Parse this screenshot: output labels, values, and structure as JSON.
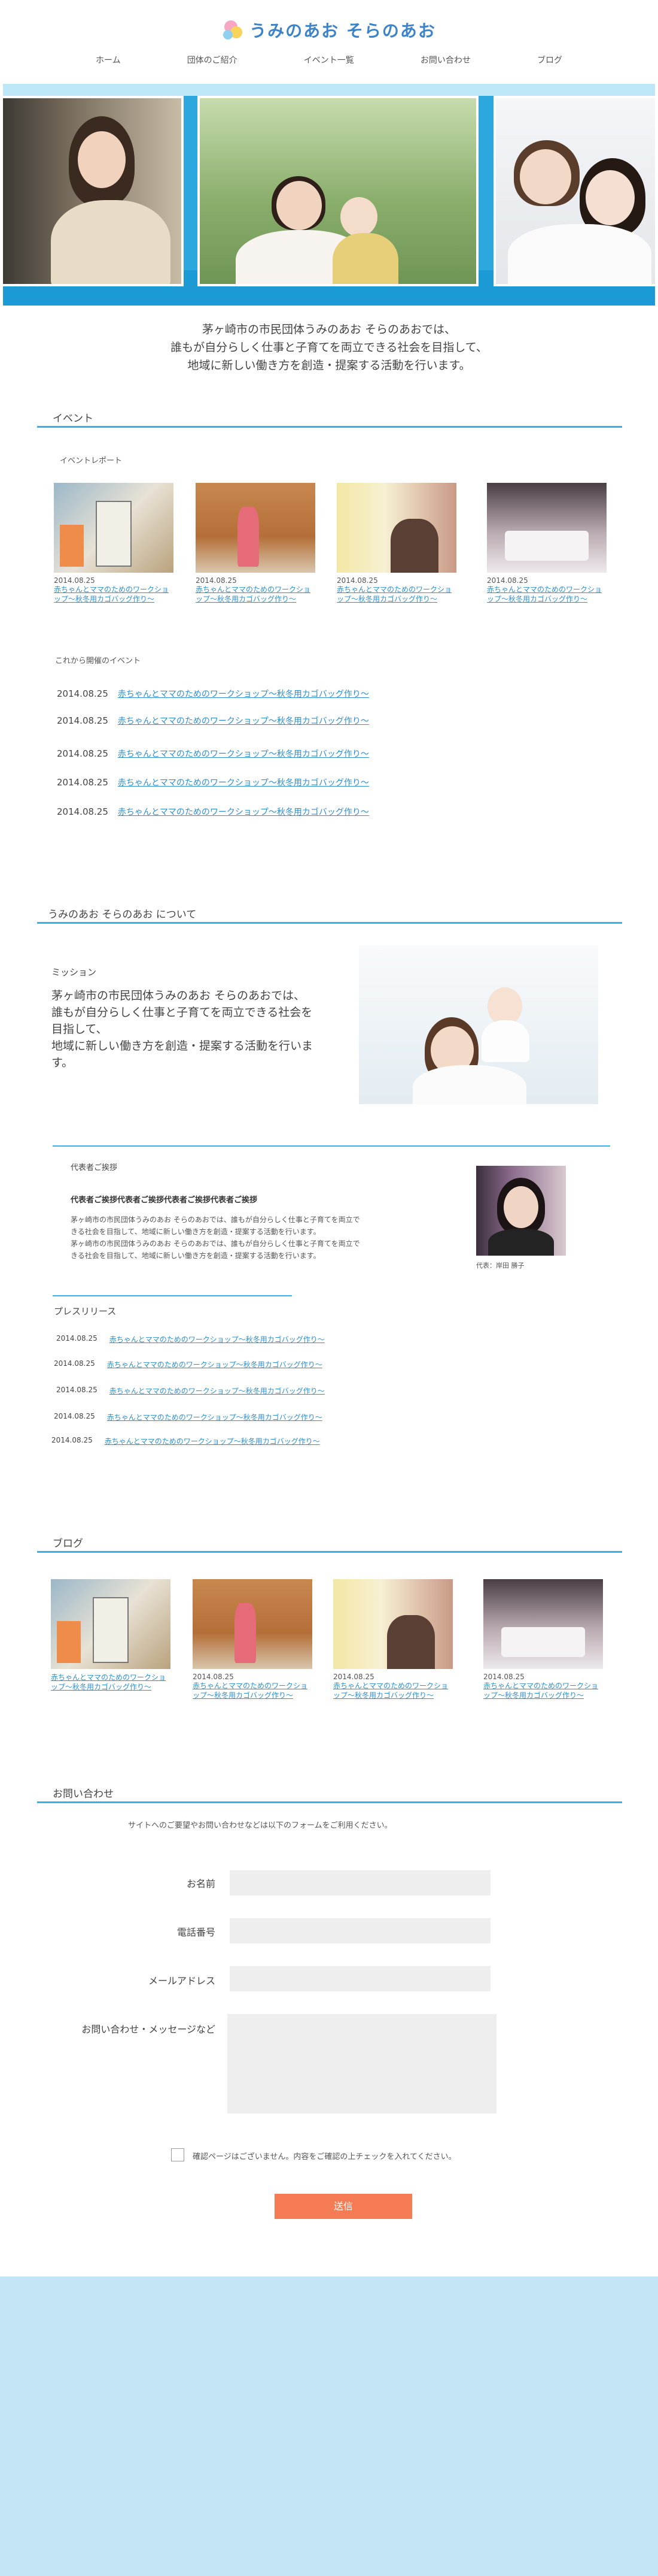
{
  "site": {
    "title": "うみのあお そらのあお"
  },
  "nav": [
    {
      "label": "ホーム"
    },
    {
      "label": "団体のご紹介"
    },
    {
      "label": "イベント一覧"
    },
    {
      "label": "お問い合わせ"
    },
    {
      "label": "ブログ"
    }
  ],
  "mission": {
    "line1": "茅ヶ崎市の市民団体うみのあお そらのあおでは、",
    "line2": "誰もが自分らしく仕事と子育てを両立できる社会を目指して、",
    "line3": "地域に新しい働き方を創造・提案する活動を行います。"
  },
  "events": {
    "heading": "イベント",
    "report_heading": "イベントレポート",
    "reports": [
      {
        "date": "2014.08.25",
        "title": "赤ちゃんとママのためのワークショップ〜秋冬用カゴバッグ作り〜"
      },
      {
        "date": "2014.08.25",
        "title": "赤ちゃんとママのためのワークショップ〜秋冬用カゴバッグ作り〜"
      },
      {
        "date": "2014.08.25",
        "title": "赤ちゃんとママのためのワークショップ〜秋冬用カゴバッグ作り〜"
      },
      {
        "date": "2014.08.25",
        "title": "赤ちゃんとママのためのワークショップ〜秋冬用カゴバッグ作り〜"
      }
    ],
    "upcoming_heading": "これから開催のイベント",
    "upcoming": [
      {
        "date": "2014.08.25",
        "title": "赤ちゃんとママのためのワークショップ〜秋冬用カゴバッグ作り〜"
      },
      {
        "date": "2014.08.25",
        "title": "赤ちゃんとママのためのワークショップ〜秋冬用カゴバッグ作り〜"
      },
      {
        "date": "2014.08.25",
        "title": "赤ちゃんとママのためのワークショップ〜秋冬用カゴバッグ作り〜"
      },
      {
        "date": "2014.08.25",
        "title": "赤ちゃんとママのためのワークショップ〜秋冬用カゴバッグ作り〜"
      },
      {
        "date": "2014.08.25",
        "title": "赤ちゃんとママのためのワークショップ〜秋冬用カゴバッグ作り〜"
      }
    ]
  },
  "about": {
    "heading": "うみのあお そらのあお について",
    "mission_label": "ミッション",
    "mission_line1": "茅ヶ崎市の市民団体うみのあお そらのあおでは、",
    "mission_line2": "誰もが自分らしく仕事と子育てを両立できる社会を",
    "mission_line3": "目指して、",
    "mission_line4": "地域に新しい働き方を創造・提案する活動を行いま",
    "mission_line5": "す。",
    "greeting_heading": "代表者ご挨拶",
    "greeting_title": "代表者ご挨拶代表者ご挨拶代表者ご挨拶代表者ご挨拶",
    "greeting_line1": "茅ヶ崎市の市民団体うみのあお そらのあおでは、誰もが自分らしく仕事と子育てを両立で",
    "greeting_line2": "きる社会を目指して、地域に新しい働き方を創造・提案する活動を行います。",
    "greeting_line3": "茅ヶ崎市の市民団体うみのあお そらのあおでは、誰もが自分らしく仕事と子育てを両立で",
    "greeting_line4": "きる社会を目指して、地域に新しい働き方を創造・提案する活動を行います。",
    "rep_caption": "代表：岸田 勝子"
  },
  "press": {
    "heading": "プレスリリース",
    "items": [
      {
        "date": "2014.08.25",
        "title": "赤ちゃんとママのためのワークショップ〜秋冬用カゴバッグ作り〜"
      },
      {
        "date": "2014.08.25",
        "title": "赤ちゃんとママのためのワークショップ〜秋冬用カゴバッグ作り〜"
      },
      {
        "date": "2014.08.25",
        "title": "赤ちゃんとママのためのワークショップ〜秋冬用カゴバッグ作り〜"
      },
      {
        "date": "2014.08.25",
        "title": "赤ちゃんとママのためのワークショップ〜秋冬用カゴバッグ作り〜"
      },
      {
        "date": "2014.08.25",
        "title": "赤ちゃんとママのためのワークショップ〜秋冬用カゴバッグ作り〜"
      }
    ]
  },
  "blog": {
    "heading": "ブログ",
    "items": [
      {
        "date": "",
        "title": "赤ちゃんとママのためのワークショップ〜秋冬用カゴバッグ作り〜"
      },
      {
        "date": "2014.08.25",
        "title": "赤ちゃんとママのためのワークショップ〜秋冬用カゴバッグ作り〜"
      },
      {
        "date": "2014.08.25",
        "title": "赤ちゃんとママのためのワークショップ〜秋冬用カゴバッグ作り〜"
      },
      {
        "date": "2014.08.25",
        "title": "赤ちゃんとママのためのワークショップ〜秋冬用カゴバッグ作り〜"
      }
    ]
  },
  "contact": {
    "heading": "お問い合わせ",
    "intro": "サイトへのご要望やお問い合わせなどは以下のフォームをご利用ください。",
    "name_label": "お名前",
    "phone_label": "電話番号",
    "email_label": "メールアドレス",
    "message_label": "お問い合わせ・メッセージなど",
    "confirm_text": "確認ページはございません。内容をご確認の上チェックを入れてください。",
    "submit_label": "送信"
  },
  "colors": {
    "accent": "#36b2e6",
    "link": "#2e8fd0",
    "submit": "#f47b53",
    "footer": "#c3e5f5"
  }
}
